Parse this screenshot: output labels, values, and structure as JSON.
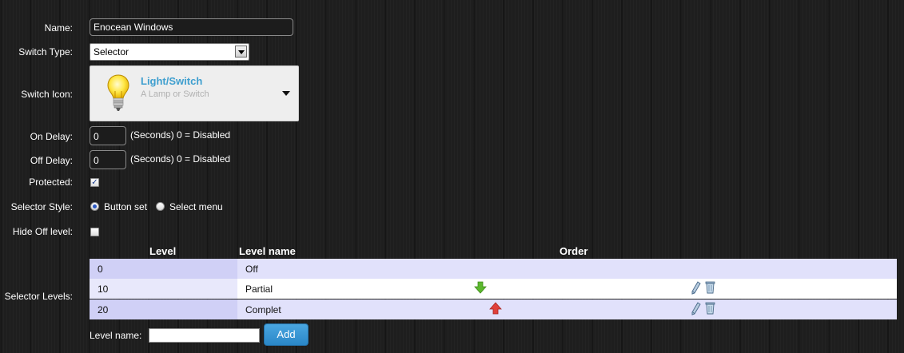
{
  "form": {
    "name_label": "Name:",
    "name_value": "Enocean Windows",
    "switch_type_label": "Switch Type:",
    "switch_type_value": "Selector",
    "switch_icon_label": "Switch Icon:",
    "icon_title": "Light/Switch",
    "icon_description": "A Lamp or Switch",
    "icon_name": "lightbulb-icon",
    "on_delay_label": "On Delay:",
    "on_delay_value": "0",
    "on_delay_hint": "(Seconds) 0 = Disabled",
    "off_delay_label": "Off Delay:",
    "off_delay_value": "0",
    "off_delay_hint": "(Seconds) 0 = Disabled",
    "protected_label": "Protected:",
    "protected_checked": true,
    "selector_style_label": "Selector Style:",
    "style_option_button_set": "Button set",
    "style_option_select_menu": "Select menu",
    "selected_style": "Button set",
    "hide_off_label": "Hide Off level:",
    "hide_off_checked": false
  },
  "levels": {
    "section_label": "Selector Levels:",
    "columns": [
      "Level",
      "Level name",
      "Order"
    ],
    "rows": [
      {
        "level": "0",
        "name": "Off",
        "order_icon": null,
        "editable": false
      },
      {
        "level": "10",
        "name": "Partial",
        "order_icon": "arrow-down-icon",
        "editable": true
      },
      {
        "level": "20",
        "name": "Complet",
        "order_icon": "arrow-up-icon",
        "editable": true
      }
    ],
    "new_level_label": "Level name:",
    "new_level_value": "",
    "add_button_label": "Add"
  },
  "colors": {
    "accent": "#3f9fcf",
    "add_button": "#2f8fd0",
    "arrow_down": "#5cb82e",
    "arrow_up": "#e0403a",
    "row_odd": "#e1e1fb",
    "row_even": "#ffffff"
  }
}
